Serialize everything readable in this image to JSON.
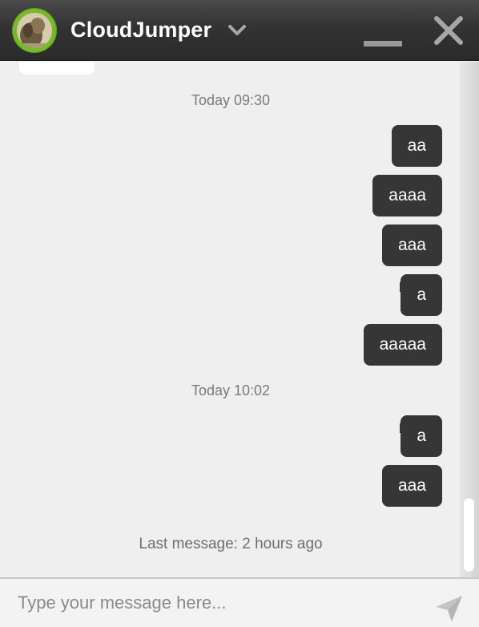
{
  "header": {
    "title": "CloudJumper",
    "avatar_icon": "user-avatar-photo",
    "dropdown_icon": "chevron-down-icon",
    "minimize_icon": "minimize-icon",
    "close_icon": "close-icon"
  },
  "messages": {
    "groups": [
      {
        "timestamp": "Today 09:30",
        "items": [
          "aa",
          "aaaa",
          "aaa",
          "a",
          "aaaaa"
        ]
      },
      {
        "timestamp": "Today 10:02",
        "items": [
          "a",
          "aaa"
        ]
      }
    ],
    "last_message": "Last message: 2 hours ago"
  },
  "composer": {
    "placeholder": "Type your message here...",
    "value": "",
    "send_icon": "send-icon"
  },
  "colors": {
    "header": "#333333",
    "bubble": "#363636",
    "background": "#efefef",
    "avatar_ring": "#78b82a"
  }
}
